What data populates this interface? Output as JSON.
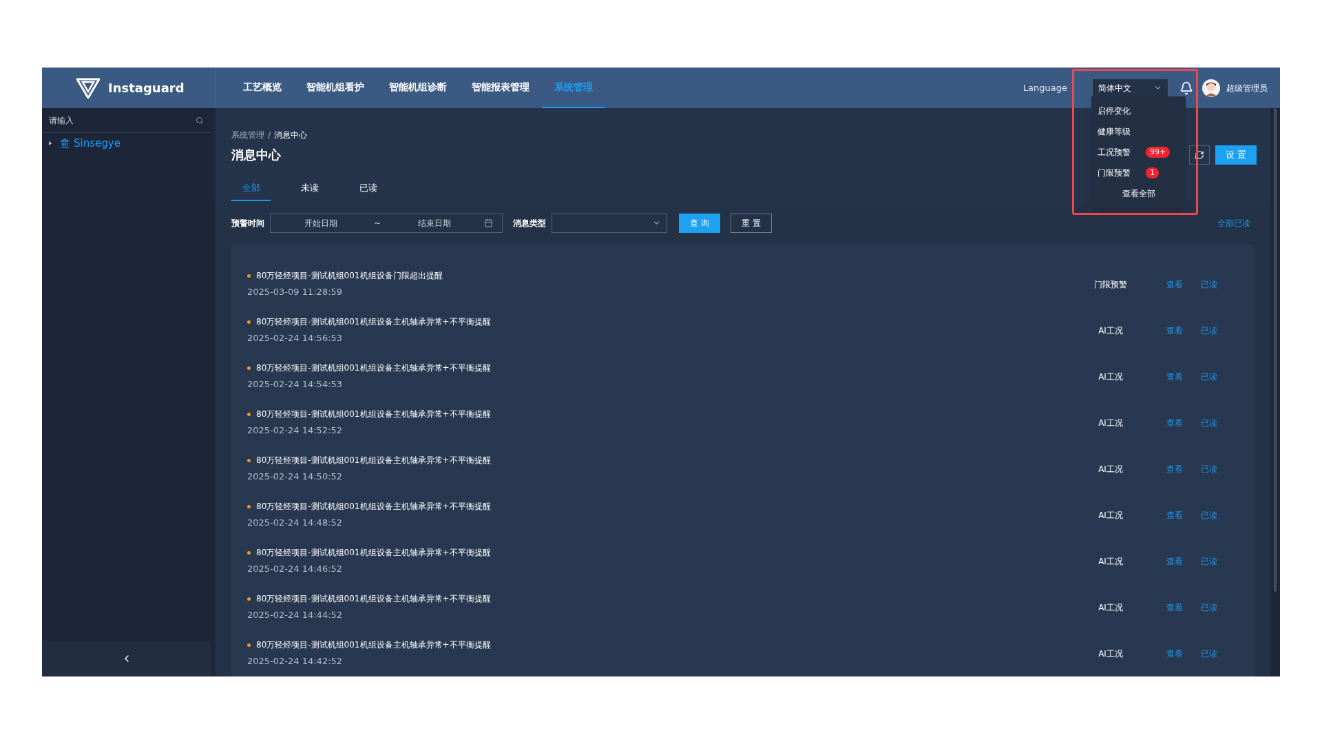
{
  "brand": "Instaguard",
  "nav": [
    {
      "label": "工艺概览",
      "selected": false
    },
    {
      "label": "智能机组看护",
      "selected": false
    },
    {
      "label": "智能机组诊断",
      "selected": false
    },
    {
      "label": "智能报表管理",
      "selected": false
    },
    {
      "label": "系统管理",
      "selected": true
    }
  ],
  "language_label": "Language",
  "language": "简体中文",
  "user": "超级管理员",
  "notifications": [
    {
      "label": "启停变化"
    },
    {
      "label": "健康等级"
    },
    {
      "label": "工况预警",
      "badge": "99+"
    },
    {
      "label": "门限预警",
      "badge": "1"
    }
  ],
  "view_all": "查看全部",
  "sidebar": {
    "search_placeholder": "请输入",
    "tree": [
      {
        "label": "Sinsegye",
        "expanded": false
      }
    ]
  },
  "breadcrumb": [
    "系统管理",
    "/",
    "消息中心"
  ],
  "title": "消息中心",
  "settings_button": "设 置",
  "tabs": [
    {
      "label": "全部",
      "selected": true
    },
    {
      "label": "未读",
      "selected": false
    },
    {
      "label": "已读",
      "selected": false
    }
  ],
  "filters": {
    "time_label": "预警时间",
    "start_placeholder": "开始日期",
    "separator": "~",
    "end_placeholder": "结束日期",
    "type_label": "消息类型",
    "query": "查 询",
    "reset": "重 置",
    "mark_all_read": "全部已读"
  },
  "messages": [
    {
      "text": "80万轻烃项目-测试机组001机组设备门限超出提醒",
      "time": "2025-03-09 11:28:59",
      "type": "门限预警",
      "view": "查看",
      "read": "已读"
    },
    {
      "text": "80万轻烃项目-测试机组001机组设备主机轴承异常+不平衡提醒",
      "time": "2025-02-24 14:56:53",
      "type": "AI工况",
      "view": "查看",
      "read": "已读"
    },
    {
      "text": "80万轻烃项目-测试机组001机组设备主机轴承异常+不平衡提醒",
      "time": "2025-02-24 14:54:53",
      "type": "AI工况",
      "view": "查看",
      "read": "已读"
    },
    {
      "text": "80万轻烃项目-测试机组001机组设备主机轴承异常+不平衡提醒",
      "time": "2025-02-24 14:52:52",
      "type": "AI工况",
      "view": "查看",
      "read": "已读"
    },
    {
      "text": "80万轻烃项目-测试机组001机组设备主机轴承异常+不平衡提醒",
      "time": "2025-02-24 14:50:52",
      "type": "AI工况",
      "view": "查看",
      "read": "已读"
    },
    {
      "text": "80万轻烃项目-测试机组001机组设备主机轴承异常+不平衡提醒",
      "time": "2025-02-24 14:48:52",
      "type": "AI工况",
      "view": "查看",
      "read": "已读"
    },
    {
      "text": "80万轻烃项目-测试机组001机组设备主机轴承异常+不平衡提醒",
      "time": "2025-02-24 14:46:52",
      "type": "AI工况",
      "view": "查看",
      "read": "已读"
    },
    {
      "text": "80万轻烃项目-测试机组001机组设备主机轴承异常+不平衡提醒",
      "time": "2025-02-24 14:44:52",
      "type": "AI工况",
      "view": "查看",
      "read": "已读"
    },
    {
      "text": "80万轻烃项目-测试机组001机组设备主机轴承异常+不平衡提醒",
      "time": "2025-02-24 14:42:52",
      "type": "AI工况",
      "view": "查看",
      "read": "已读"
    }
  ]
}
